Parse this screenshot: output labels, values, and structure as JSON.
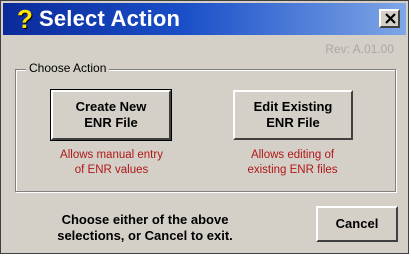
{
  "window": {
    "title": "Select Action",
    "title_icon": "?",
    "close_icon": "close-icon",
    "revision": "Rev: A.01.00"
  },
  "group": {
    "label": "Choose Action"
  },
  "buttons": {
    "create": {
      "line1": "Create New",
      "line2": "ENR File"
    },
    "edit": {
      "line1": "Edit Existing",
      "line2": "ENR File"
    },
    "cancel": "Cancel"
  },
  "descriptions": {
    "create": {
      "line1": "Allows manual entry",
      "line2": "of ENR values"
    },
    "edit": {
      "line1": "Allows editing of",
      "line2": "existing ENR files"
    }
  },
  "instruction": {
    "line1": "Choose either of the above",
    "line2": "selections, or Cancel to exit."
  },
  "colors": {
    "titlebar_start": "#0a2a9b",
    "titlebar_end": "#7fa6e6",
    "face": "#d4d0c8",
    "description_text": "#b01818",
    "icon_yellow": "#ffe600"
  }
}
